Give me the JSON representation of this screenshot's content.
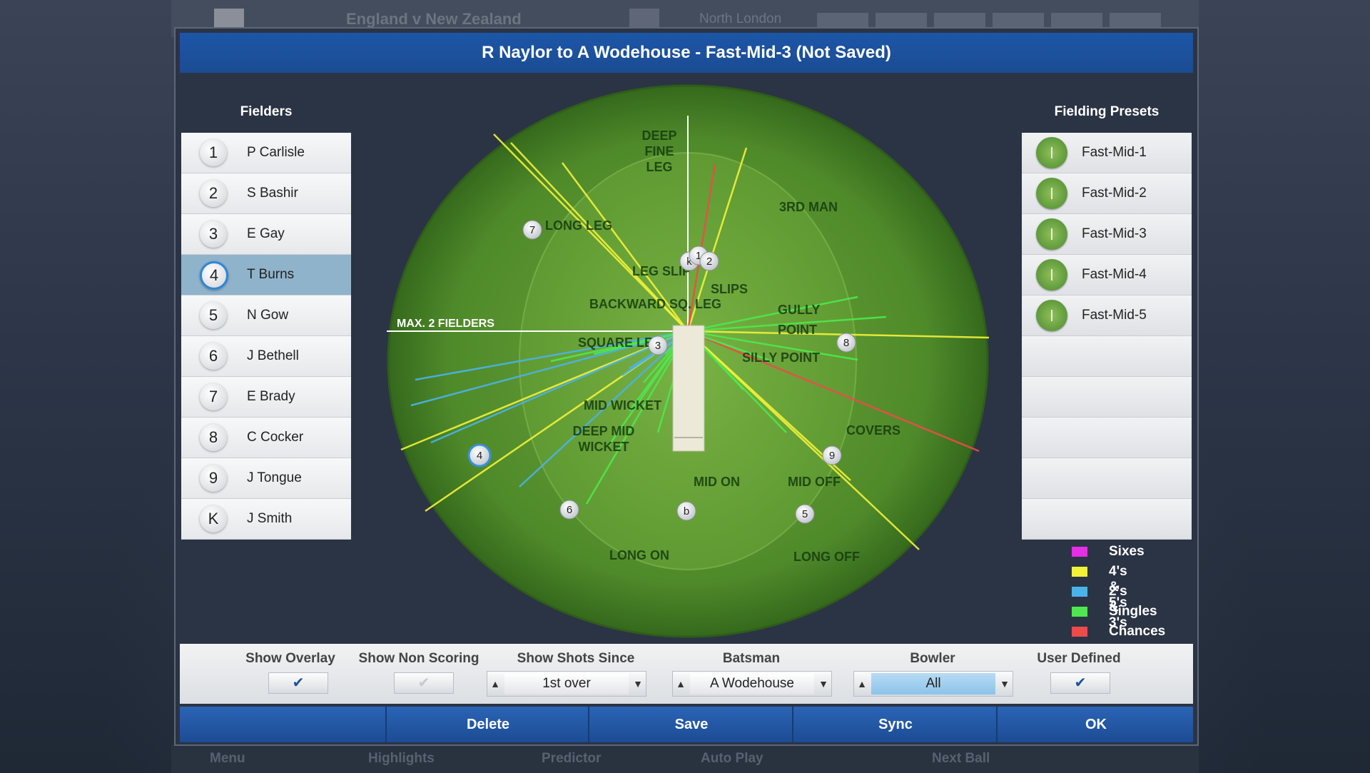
{
  "background": {
    "match_title": "England v New Zealand",
    "venue": "North London",
    "nav": [
      "Menu",
      "Highlights",
      "Predictor",
      "Auto Play",
      "Next Ball"
    ]
  },
  "dialog": {
    "title": "R Naylor to A Wodehouse - Fast-Mid-3 (Not Saved)",
    "fielders_label": "Fielders",
    "presets_label": "Fielding Presets"
  },
  "fielders": [
    {
      "num": "1",
      "name": "P Carlisle",
      "selected": false
    },
    {
      "num": "2",
      "name": "S Bashir",
      "selected": false
    },
    {
      "num": "3",
      "name": "E Gay",
      "selected": false
    },
    {
      "num": "4",
      "name": "T Burns",
      "selected": true
    },
    {
      "num": "5",
      "name": "N Gow",
      "selected": false
    },
    {
      "num": "6",
      "name": "J Bethell",
      "selected": false
    },
    {
      "num": "7",
      "name": "E Brady",
      "selected": false
    },
    {
      "num": "8",
      "name": "C Cocker",
      "selected": false
    },
    {
      "num": "9",
      "name": "J Tongue",
      "selected": false
    },
    {
      "num": "K",
      "name": "J Smith",
      "selected": false
    }
  ],
  "presets": [
    "Fast-Mid-1",
    "Fast-Mid-2",
    "Fast-Mid-3",
    "Fast-Mid-4",
    "Fast-Mid-5"
  ],
  "legend": [
    {
      "label": "Sixes",
      "color": "#e52ee5"
    },
    {
      "label": "4's & 5's",
      "color": "#f2f23a"
    },
    {
      "label": "2's & 3's",
      "color": "#4ab3ea"
    },
    {
      "label": "Singles",
      "color": "#4ee84e"
    },
    {
      "label": "Chances",
      "color": "#ee4a4a"
    }
  ],
  "field": {
    "max_fielders_label": "MAX. 2 FIELDERS",
    "positions": [
      {
        "label": "DEEP FINE LEG"
      },
      {
        "label": "3RD MAN"
      },
      {
        "label": "LONG LEG"
      },
      {
        "label": "LEG SLIP"
      },
      {
        "label": "SLIPS"
      },
      {
        "label": "BACKWARD SQ. LEG"
      },
      {
        "label": "GULLY"
      },
      {
        "label": "POINT"
      },
      {
        "label": "SQUARE LEG"
      },
      {
        "label": "SILLY POINT"
      },
      {
        "label": "MID WICKET"
      },
      {
        "label": "DEEP MID WICKET"
      },
      {
        "label": "COVERS"
      },
      {
        "label": "MID ON"
      },
      {
        "label": "MID OFF"
      },
      {
        "label": "LONG ON"
      },
      {
        "label": "LONG OFF"
      }
    ],
    "markers": [
      "k",
      "1",
      "2",
      "7",
      "3",
      "8",
      "4",
      "9",
      "6",
      "b",
      "5"
    ]
  },
  "controls": {
    "show_overlay": {
      "label": "Show Overlay",
      "checked": true
    },
    "show_non_scoring": {
      "label": "Show Non Scoring",
      "checked": false
    },
    "show_shots_since": {
      "label": "Show Shots Since",
      "value": "1st over"
    },
    "batsman": {
      "label": "Batsman",
      "value": "A Wodehouse"
    },
    "bowler": {
      "label": "Bowler",
      "value": "All"
    },
    "user_defined": {
      "label": "User Defined",
      "checked": true
    },
    "check_glyph": "✔",
    "up_glyph": "▲",
    "down_glyph": "▼"
  },
  "buttons": {
    "delete": "Delete",
    "save": "Save",
    "sync": "Sync",
    "ok": "OK"
  }
}
